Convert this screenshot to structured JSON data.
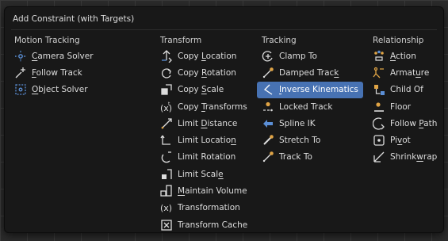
{
  "menu": {
    "title": "Add Constraint (with Targets)"
  },
  "columns": [
    {
      "header": "Motion Tracking",
      "items": [
        {
          "pre": "",
          "key": "C",
          "post": "amera Solver",
          "icon": "camera-solver-icon"
        },
        {
          "pre": "",
          "key": "F",
          "post": "ollow Track",
          "icon": "follow-track-icon"
        },
        {
          "pre": "",
          "key": "O",
          "post": "bject Solver",
          "icon": "object-solver-icon"
        }
      ]
    },
    {
      "header": "Transform",
      "items": [
        {
          "pre": "Copy ",
          "key": "L",
          "post": "ocation",
          "icon": "copy-location-icon"
        },
        {
          "pre": "Copy ",
          "key": "R",
          "post": "otation",
          "icon": "copy-rotation-icon"
        },
        {
          "pre": "Copy ",
          "key": "S",
          "post": "cale",
          "icon": "copy-scale-icon"
        },
        {
          "pre": "Copy ",
          "key": "T",
          "post": "ransforms",
          "icon": "copy-transforms-icon"
        },
        {
          "pre": "Limit ",
          "key": "D",
          "post": "istance",
          "icon": "limit-distance-icon"
        },
        {
          "pre": "Limit Locatio",
          "key": "n",
          "post": "",
          "icon": "limit-location-icon"
        },
        {
          "pre": "Limit Rotation",
          "key": "",
          "post": "",
          "icon": "limit-rotation-icon"
        },
        {
          "pre": "Limit Scal",
          "key": "e",
          "post": "",
          "icon": "limit-scale-icon"
        },
        {
          "pre": "",
          "key": "M",
          "post": "aintain Volume",
          "icon": "maintain-volume-icon"
        },
        {
          "pre": "Transformation",
          "key": "",
          "post": "",
          "icon": "transformation-icon"
        },
        {
          "pre": "Transform Cache",
          "key": "",
          "post": "",
          "icon": "transform-cache-icon"
        }
      ]
    },
    {
      "header": "Tracking",
      "items": [
        {
          "pre": "Clamp To",
          "key": "",
          "post": "",
          "icon": "clamp-to-icon"
        },
        {
          "pre": "Damped Trac",
          "key": "k",
          "post": "",
          "icon": "damped-track-icon"
        },
        {
          "pre": "",
          "key": "I",
          "post": "nverse Kinematics",
          "icon": "inverse-kinematics-icon",
          "active": true
        },
        {
          "pre": "Locked Track",
          "key": "",
          "post": "",
          "icon": "locked-track-icon"
        },
        {
          "pre": "Spline IK",
          "key": "",
          "post": "",
          "icon": "spline-ik-icon"
        },
        {
          "pre": "Stretch To",
          "key": "",
          "post": "",
          "icon": "stretch-to-icon"
        },
        {
          "pre": "Track To",
          "key": "",
          "post": "",
          "icon": "track-to-icon"
        }
      ]
    },
    {
      "header": "Relationship",
      "items": [
        {
          "pre": "",
          "key": "A",
          "post": "ction",
          "icon": "action-icon"
        },
        {
          "pre": "Armat",
          "key": "u",
          "post": "re",
          "icon": "armature-icon"
        },
        {
          "pre": "Child Of",
          "key": "",
          "post": "",
          "icon": "child-of-icon"
        },
        {
          "pre": "Floor",
          "key": "",
          "post": "",
          "icon": "floor-icon"
        },
        {
          "pre": "Follow ",
          "key": "P",
          "post": "ath",
          "icon": "follow-path-icon"
        },
        {
          "pre": "Pi",
          "key": "v",
          "post": "ot",
          "icon": "pivot-icon"
        },
        {
          "pre": "Shrink",
          "key": "w",
          "post": "rap",
          "icon": "shrinkwrap-icon"
        }
      ]
    }
  ],
  "colors": {
    "menu_bg": "#181818",
    "text": "#dcdcdc",
    "highlight": "#4772b3",
    "icon_orange": "#e0a445",
    "icon_blue": "#5b8fd6",
    "icon_white": "#dcdcdc"
  }
}
